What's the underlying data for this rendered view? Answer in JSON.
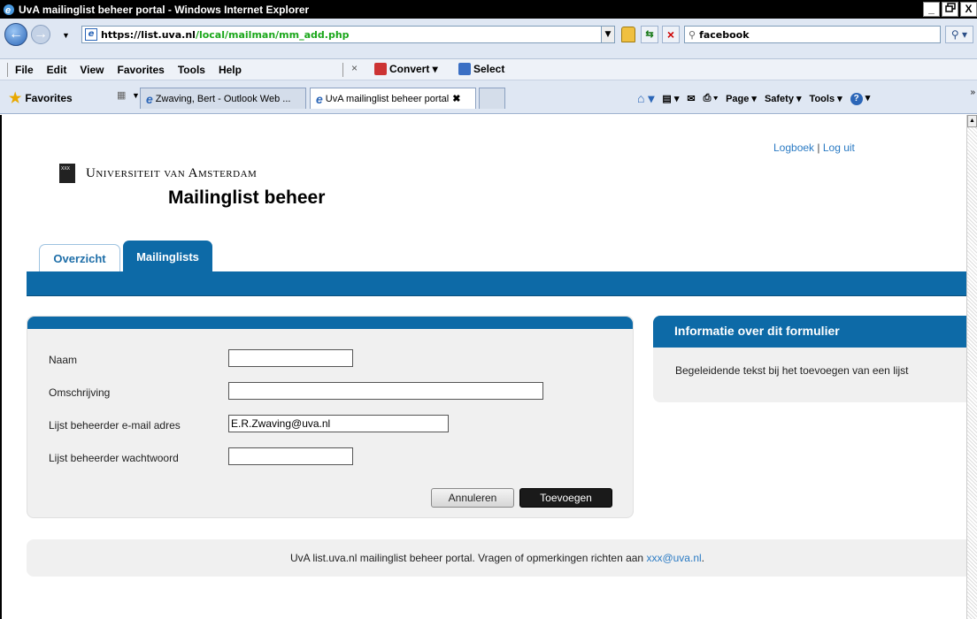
{
  "window": {
    "title": "UvA mailinglist beheer portal - Windows Internet Explorer",
    "buttons": [
      "_",
      "ع",
      "X"
    ]
  },
  "address": {
    "url_host": "https://list.uva.nl",
    "url_path": "/local/mailman/mm_add.php",
    "search_value": "facebook"
  },
  "menu": {
    "items": [
      "File",
      "Edit",
      "View",
      "Favorites",
      "Tools",
      "Help"
    ],
    "convert": "Convert",
    "select": "Select"
  },
  "favorites": {
    "label": "Favorites",
    "tabs": [
      {
        "label": "Zwaving, Bert - Outlook Web ..."
      },
      {
        "label": "UvA mailinglist beheer portal"
      }
    ],
    "commands": [
      "Page",
      "Safety",
      "Tools"
    ]
  },
  "header": {
    "links": {
      "logbook": "Logboek",
      "separator": "|",
      "logout": "Log uit"
    },
    "logo_text": "Universiteit van Amsterdam",
    "site_title": "Mailinglist beheer"
  },
  "nav": {
    "tabs": [
      "Overzicht",
      "Mailinglists"
    ]
  },
  "form": {
    "fields": [
      {
        "label": "Naam",
        "value": ""
      },
      {
        "label": "Omschrijving",
        "value": ""
      },
      {
        "label": "Lijst beheerder e-mail adres",
        "value": "E.R.Zwaving@uva.nl"
      },
      {
        "label": "Lijst beheerder wachtwoord",
        "value": ""
      }
    ],
    "cancel_label": "Annuleren",
    "submit_label": "Toevoegen"
  },
  "info": {
    "title": "Informatie over dit formulier",
    "text": "Begeleidende tekst bij het toevoegen van een lijst"
  },
  "footer": {
    "text": "UvA list.uva.nl mailinglist beheer portal. Vragen of opmerkingen richten aan ",
    "email": "xxx@uva.nl",
    "suffix": "."
  },
  "colors": {
    "brand_blue": "#0d6aa7",
    "link_blue": "#2b7bc4",
    "url_path_green": "#1aa71a"
  }
}
